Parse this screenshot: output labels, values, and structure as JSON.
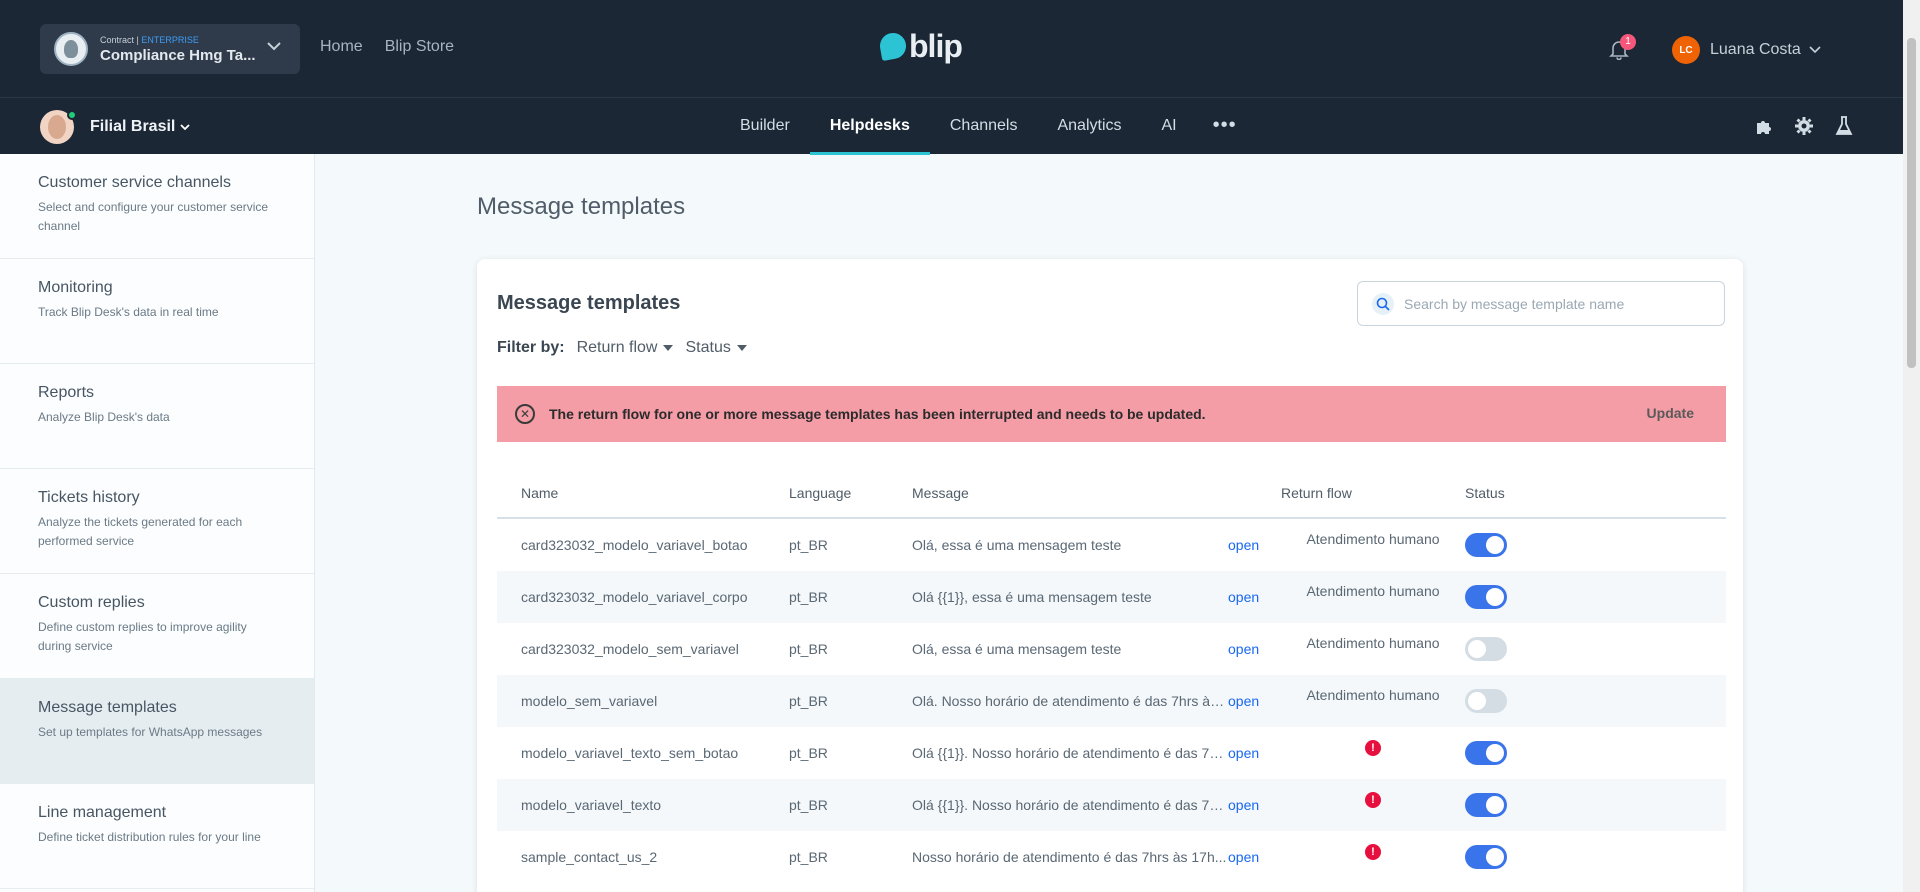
{
  "header": {
    "contract_label": "Contract |",
    "contract_tier": "ENTERPRISE",
    "contract_name": "Compliance Hmg Ta...",
    "nav": [
      "Home",
      "Blip Store"
    ],
    "logo_text": "blip",
    "notification_count": "1",
    "user_initials": "LC",
    "user_name": "Luana Costa"
  },
  "subheader": {
    "bot_name": "Filial Brasil",
    "tabs": [
      "Builder",
      "Helpdesks",
      "Channels",
      "Analytics",
      "AI"
    ],
    "active_tab": "Helpdesks",
    "more": "•••"
  },
  "sidebar": {
    "items": [
      {
        "title": "Customer service channels",
        "desc": "Select and configure your customer service channel"
      },
      {
        "title": "Monitoring",
        "desc": "Track Blip Desk's data in real time"
      },
      {
        "title": "Reports",
        "desc": "Analyze Blip Desk's data"
      },
      {
        "title": "Tickets history",
        "desc": "Analyze the tickets generated for each performed service"
      },
      {
        "title": "Custom replies",
        "desc": "Define custom replies to improve agility during service"
      },
      {
        "title": "Message templates",
        "desc": "Set up templates for WhatsApp messages"
      },
      {
        "title": "Line management",
        "desc": "Define ticket distribution rules for your line"
      }
    ],
    "active_index": 5
  },
  "main": {
    "page_title": "Message templates",
    "card_title": "Message templates",
    "search_placeholder": "Search by message template name",
    "filter_label": "Filter by:",
    "filter_options": [
      "Return flow",
      "Status"
    ],
    "alert_text": "The return flow for one or more message templates has been interrupted and needs to be updated.",
    "alert_action": "Update",
    "columns": [
      "Name",
      "Language",
      "Message",
      "Return flow",
      "Status"
    ],
    "rows": [
      {
        "name": "card323032_modelo_variavel_botao",
        "lang": "pt_BR",
        "message": "Olá, essa é uma mensagem teste",
        "link": "open",
        "flow": "Atendimento humano",
        "flow_error": false,
        "status_on": true
      },
      {
        "name": "card323032_modelo_variavel_corpo",
        "lang": "pt_BR",
        "message": "Olá {{1}}, essa é uma mensagem teste",
        "link": "open",
        "flow": "Atendimento humano",
        "flow_error": false,
        "status_on": true
      },
      {
        "name": "card323032_modelo_sem_variavel",
        "lang": "pt_BR",
        "message": "Olá, essa é uma mensagem teste",
        "link": "open",
        "flow": "Atendimento humano",
        "flow_error": false,
        "status_on": false
      },
      {
        "name": "modelo_sem_variavel",
        "lang": "pt_BR",
        "message": "Olá. Nosso horário de atendimento é das 7hrs às ...",
        "link": "open",
        "flow": "Atendimento humano",
        "flow_error": false,
        "status_on": false
      },
      {
        "name": "modelo_variavel_texto_sem_botao",
        "lang": "pt_BR",
        "message": "Olá {{1}}. Nosso horário de atendimento é das 7h...",
        "link": "open",
        "flow": "",
        "flow_error": true,
        "status_on": true
      },
      {
        "name": "modelo_variavel_texto",
        "lang": "pt_BR",
        "message": "Olá {{1}}. Nosso horário de atendimento é das 7h...",
        "link": "open",
        "flow": "",
        "flow_error": true,
        "status_on": true
      },
      {
        "name": "sample_contact_us_2",
        "lang": "pt_BR",
        "message": "Nosso horário de atendimento é das 7hrs às 17h...",
        "link": "open",
        "flow": "",
        "flow_error": true,
        "status_on": true
      }
    ]
  },
  "colors": {
    "topbar": "#1b2735",
    "accent": "#2cc3d5",
    "toggle_on": "#3a74ea",
    "alert_bg": "#f49da7",
    "error": "#e60f3e"
  }
}
